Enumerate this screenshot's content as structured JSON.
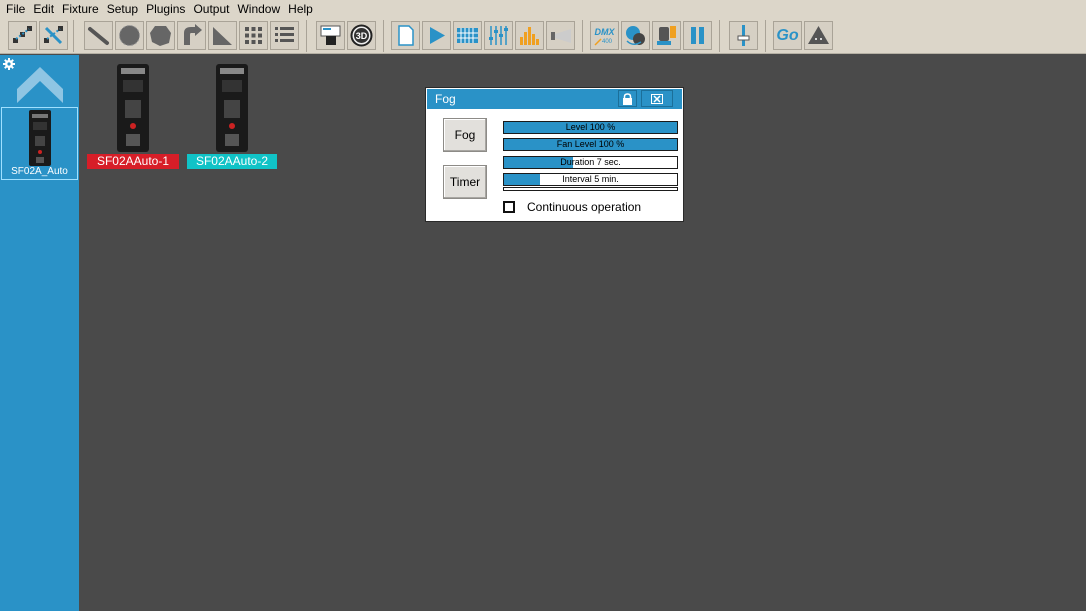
{
  "menubar": {
    "items": [
      "File",
      "Edit",
      "Fixture",
      "Setup",
      "Plugins",
      "Output",
      "Window",
      "Help"
    ]
  },
  "toolbar": {
    "go_label": "Go",
    "dmx_label": "DMX",
    "dmx_sub": "400",
    "three_d_label": "3D"
  },
  "sidebar": {
    "fixture_label": "SF02A_Auto"
  },
  "canvas": {
    "fixtures": [
      {
        "label": "SF02AAuto-1",
        "color": "#d71e28"
      },
      {
        "label": "SF02AAuto-2",
        "color": "#10c3c7"
      }
    ]
  },
  "fog_panel": {
    "title": "Fog",
    "fog_button": "Fog",
    "timer_button": "Timer",
    "bars": [
      {
        "label": "Level 100 %",
        "fill": 1.0
      },
      {
        "label": "Fan Level 100 %",
        "fill": 1.0
      },
      {
        "label": "Duration 7 sec.",
        "fill": 0.4
      },
      {
        "label": "Interval 5 min.",
        "fill": 0.21
      }
    ],
    "continuous_label": "Continuous operation",
    "continuous_checked": false
  },
  "colors": {
    "accent": "#2a92c7",
    "workspace": "#4a4a4a",
    "chrome": "#dcd6c9"
  }
}
